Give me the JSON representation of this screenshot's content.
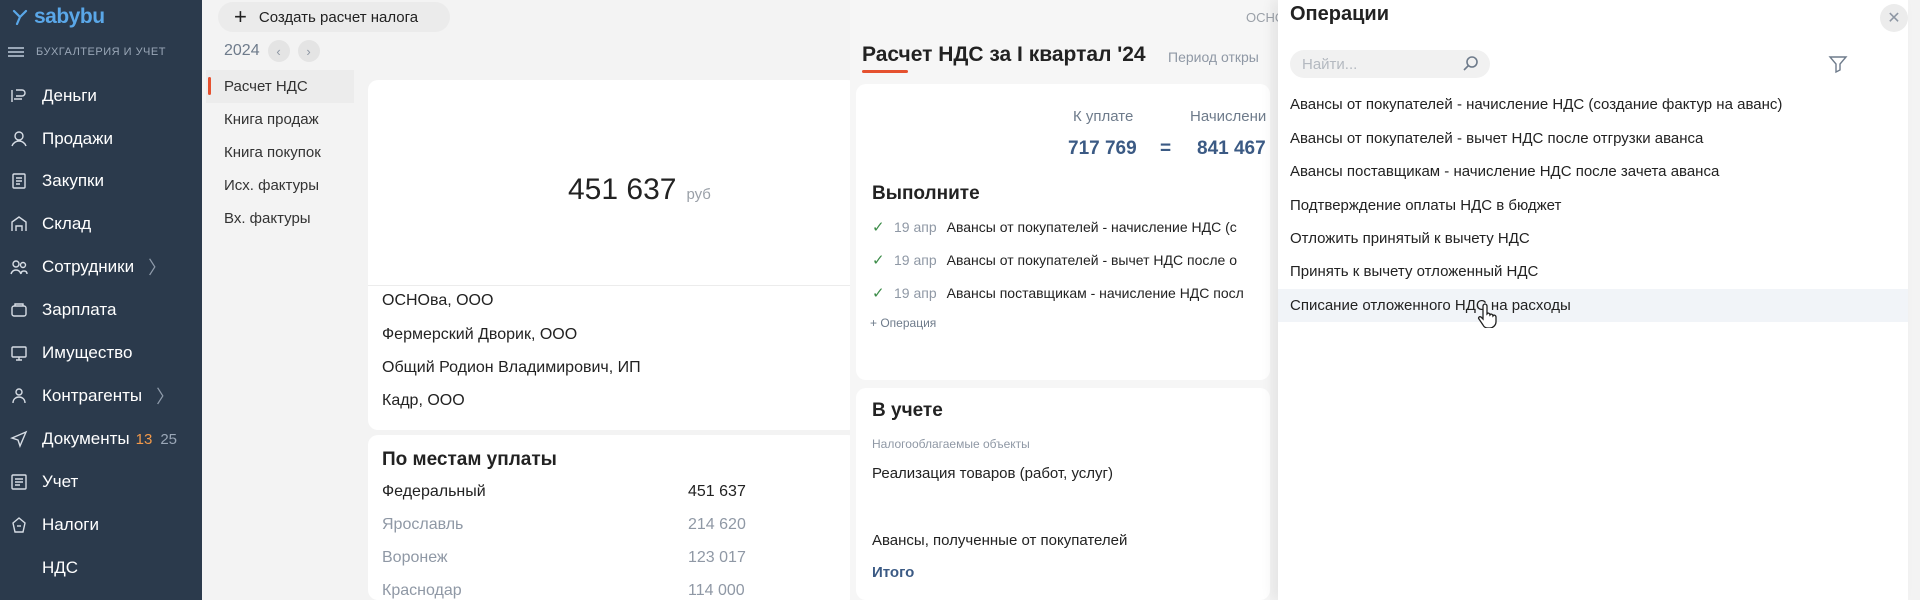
{
  "app": {
    "logo": "sabybu",
    "subtitle": "БУХГАЛТЕРИЯ И УЧЕТ"
  },
  "sidebar": {
    "items": [
      {
        "label": "Деньги",
        "icon": "money-icon"
      },
      {
        "label": "Продажи",
        "icon": "sales-icon"
      },
      {
        "label": "Закупки",
        "icon": "purchases-icon"
      },
      {
        "label": "Склад",
        "icon": "warehouse-icon"
      },
      {
        "label": "Сотрудники",
        "icon": "employees-icon",
        "chevron": "〉"
      },
      {
        "label": "Зарплата",
        "icon": "salary-icon"
      },
      {
        "label": "Имущество",
        "icon": "property-icon"
      },
      {
        "label": "Контрагенты",
        "icon": "counterparties-icon",
        "chevron": "〉"
      },
      {
        "label": "Документы",
        "icon": "documents-icon",
        "count1": "13",
        "count2": "25"
      },
      {
        "label": "Учет",
        "icon": "accounting-icon"
      },
      {
        "label": "Налоги",
        "icon": "taxes-icon"
      },
      {
        "label": "НДС",
        "icon": ""
      }
    ]
  },
  "toolbar": {
    "create_label": "Создать расчет налога",
    "year": "2024"
  },
  "subnav": [
    {
      "label": "Расчет НДС",
      "active": true
    },
    {
      "label": "Книга продаж"
    },
    {
      "label": "Книга покупок"
    },
    {
      "label": "Исх. фактуры"
    },
    {
      "label": "Вх. фактуры"
    }
  ],
  "summary": {
    "amount": "451 637",
    "unit": "руб",
    "orgs": [
      "ОСНОва, ООО",
      "Фермерский Дворик, ООО",
      "Общий Родион Владимирович, ИП",
      "Кадр, ООО"
    ],
    "places_title": "По местам уплаты",
    "places": [
      {
        "name": "Федеральный",
        "value": "451 637",
        "primary": true
      },
      {
        "name": "Ярославль",
        "value": "214 620"
      },
      {
        "name": "Воронеж",
        "value": "123 017"
      },
      {
        "name": "Краснодар",
        "value": "114 000"
      }
    ]
  },
  "report": {
    "osno_text": "ОСНО",
    "title": "Расчет НДС за I квартал '24",
    "period": "Период откры",
    "to_pay_label": "К уплате",
    "accrued_label": "Начислени",
    "to_pay": "717 769",
    "equals": "=",
    "accrued": "841 467",
    "todo_title": "Выполните",
    "tasks": [
      {
        "date": "19 апр",
        "text": "Авансы от покупателей - начисление НДС (с"
      },
      {
        "date": "19 апр",
        "text": "Авансы от покупателей - вычет НДС после о"
      },
      {
        "date": "19 апр",
        "text": "Авансы поставщикам - начисление НДС посл"
      }
    ],
    "add_op": "+ Операция",
    "accounting_title": "В учете",
    "taxable_label": "Налогооблагаемые объекты",
    "rows": [
      "Реализация товаров (работ, услуг)",
      "Авансы, полученные от покупателей"
    ],
    "total": "Итого"
  },
  "operations": {
    "title": "Операции",
    "search_placeholder": "Найти...",
    "items": [
      "Авансы от покупателей - начисление НДС (создание фактур на аванс)",
      "Авансы от покупателей - вычет НДС после отгрузки аванса",
      "Авансы поставщикам - начисление НДС после зачета аванса",
      "Подтверждение оплаты НДС в бюджет",
      "Отложить принятый к вычету НДС",
      "Принять к вычету отложенный НДС",
      "Списание отложенного НДС на расходы"
    ],
    "hovered_index": 6
  }
}
